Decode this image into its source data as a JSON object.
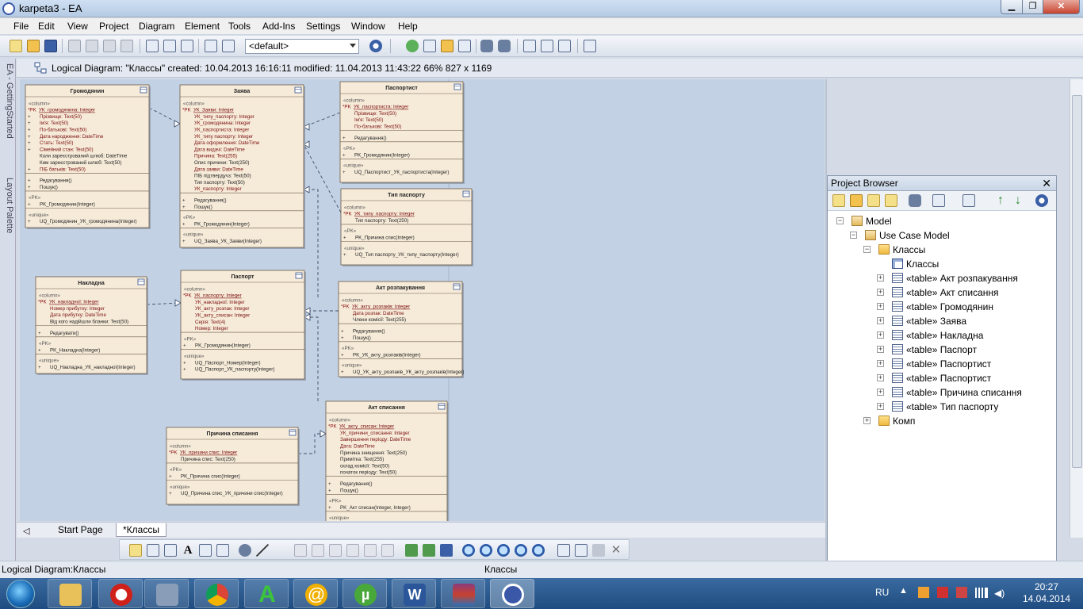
{
  "window": {
    "title": "karpeta3 - EA"
  },
  "menu": [
    "File",
    "Edit",
    "View",
    "Project",
    "Diagram",
    "Element",
    "Tools",
    "Add-Ins",
    "Settings",
    "Window",
    "Help"
  ],
  "toolbar": {
    "perspective_select": "<default>"
  },
  "side_tabs": [
    "EA - GettingStarted",
    "Layout Palette"
  ],
  "diagram_header": {
    "text": "Logical Diagram: \"Классы\"   created: 10.04.2013 16:16:11  modified: 11.04.2013 11:43:22   66%   827 x 1169"
  },
  "diagram": {
    "classes": [
      {
        "name": "Громодянин",
        "sections": [
          {
            "stereo": "«column»",
            "rows": [
              {
                "kind": "pk",
                "prefix": "*PK",
                "text": "УК_громодянина:  Integer"
              },
              {
                "kind": "col",
                "prefix": "+",
                "text": "Прізвище:  Text(50)"
              },
              {
                "kind": "col",
                "prefix": "+",
                "text": "Ім'я:  Text(50)"
              },
              {
                "kind": "col",
                "prefix": "+",
                "text": "По-батькові:  Text(50)"
              },
              {
                "kind": "col",
                "prefix": "+",
                "text": "Дата народження:  DateTime"
              },
              {
                "kind": "col",
                "prefix": "+",
                "text": "Стать:  Text(50)"
              },
              {
                "kind": "col",
                "prefix": "+",
                "text": "Сімейний стан:  Text(50)"
              },
              {
                "kind": "plain",
                "prefix": "",
                "text": "Коли зареєстрований шлюб:  DateTime"
              },
              {
                "kind": "plain",
                "prefix": "",
                "text": "Ким зареєстрований шлюб:  Text(50)"
              },
              {
                "kind": "col",
                "prefix": "+",
                "text": "ПІБ батьків:  Text(50)"
              }
            ]
          },
          {
            "stereo": "",
            "rows": [
              {
                "kind": "plain",
                "prefix": "+",
                "text": "Редагування()"
              },
              {
                "kind": "plain",
                "prefix": "+",
                "text": "Пошук()"
              }
            ]
          },
          {
            "stereo": "«PK»",
            "rows": [
              {
                "kind": "plain",
                "prefix": "+",
                "text": "PK_Громодянин(Integer)"
              }
            ]
          },
          {
            "stereo": "«unique»",
            "rows": [
              {
                "kind": "plain",
                "prefix": "+",
                "text": "UQ_Громодянин_УК_громодянина(Integer)"
              }
            ]
          }
        ]
      },
      {
        "name": "Заява",
        "sections": [
          {
            "stereo": "«column»",
            "rows": [
              {
                "kind": "pk",
                "prefix": "*PK",
                "text": "УК_Заяви:  Integer"
              },
              {
                "kind": "col",
                "prefix": "",
                "text": "УК_типу_паспорту:  Integer"
              },
              {
                "kind": "col",
                "prefix": "",
                "text": "УК_громодянина:  Integer"
              },
              {
                "kind": "col",
                "prefix": "",
                "text": "УК_паспортиста:  Integer"
              },
              {
                "kind": "col",
                "prefix": "",
                "text": "УК_типу паспорту:  Integer"
              },
              {
                "kind": "col",
                "prefix": "",
                "text": "Дата оформлення:  DateTime"
              },
              {
                "kind": "col",
                "prefix": "",
                "text": "Дата видачі:  DateTime"
              },
              {
                "kind": "col",
                "prefix": "",
                "text": "Причина:  Text(255)"
              },
              {
                "kind": "plain",
                "prefix": "",
                "text": "Опис причини:  Text(250)"
              },
              {
                "kind": "col",
                "prefix": "",
                "text": "Дата заяви:  DateTime"
              },
              {
                "kind": "plain",
                "prefix": "",
                "text": "ПІБ підтвердучз:  Text(50)"
              },
              {
                "kind": "plain",
                "prefix": "",
                "text": "Тип паспорту:  Text(50)"
              },
              {
                "kind": "col",
                "prefix": "",
                "text": "УК_паспорту:  Integer"
              }
            ]
          },
          {
            "stereo": "",
            "rows": [
              {
                "kind": "plain",
                "prefix": "+",
                "text": "Редагування()"
              },
              {
                "kind": "plain",
                "prefix": "+",
                "text": "Пошук()"
              }
            ]
          },
          {
            "stereo": "«PK»",
            "rows": [
              {
                "kind": "plain",
                "prefix": "+",
                "text": "PK_Громодянин(Integer)"
              }
            ]
          },
          {
            "stereo": "«unique»",
            "rows": [
              {
                "kind": "plain",
                "prefix": "+",
                "text": "UQ_Заява_УК_Заяви(Integer)"
              }
            ]
          }
        ]
      },
      {
        "name": "Паспортист",
        "sections": [
          {
            "stereo": "«column»",
            "rows": [
              {
                "kind": "pk",
                "prefix": "*PK",
                "text": "УК_паспортиста:  Integer"
              },
              {
                "kind": "col",
                "prefix": "",
                "text": "Прізвище:  Text(50)"
              },
              {
                "kind": "col",
                "prefix": "",
                "text": "Ім'я:  Text(50)"
              },
              {
                "kind": "col",
                "prefix": "",
                "text": "По-батькові:  Text(50)"
              }
            ]
          },
          {
            "stereo": "",
            "rows": [
              {
                "kind": "plain",
                "prefix": "+",
                "text": "Редагування()"
              }
            ]
          },
          {
            "stereo": "«PK»",
            "rows": [
              {
                "kind": "plain",
                "prefix": "+",
                "text": "PK_Громодянин(Integer)"
              }
            ]
          },
          {
            "stereo": "«unique»",
            "rows": [
              {
                "kind": "plain",
                "prefix": "+",
                "text": "UQ_Паспортист_УК_паспортиста(Integer)"
              }
            ]
          }
        ]
      },
      {
        "name": "Тип паспорту",
        "sections": [
          {
            "stereo": "«column»",
            "rows": [
              {
                "kind": "pk",
                "prefix": "*PK",
                "text": "УК_типу_паспорту:  Integer"
              },
              {
                "kind": "plain",
                "prefix": "",
                "text": "Тип паспорту:  Text(250)"
              }
            ]
          },
          {
            "stereo": "«PK»",
            "rows": [
              {
                "kind": "plain",
                "prefix": "+",
                "text": "PK_Причина спис(Integer)"
              }
            ]
          },
          {
            "stereo": "«unique»",
            "rows": [
              {
                "kind": "plain",
                "prefix": "+",
                "text": "UQ_Тип паспорту_УК_типу_паспорту(Integer)"
              }
            ]
          }
        ]
      },
      {
        "name": "Накладна",
        "sections": [
          {
            "stereo": "«column»",
            "rows": [
              {
                "kind": "pk",
                "prefix": "*PK",
                "text": "УК_накладної:  Integer"
              },
              {
                "kind": "col",
                "prefix": "",
                "text": "Номер прибутку:  Integer"
              },
              {
                "kind": "col",
                "prefix": "",
                "text": "Дата прибутку:  DateTime"
              },
              {
                "kind": "plain",
                "prefix": "",
                "text": "Від кого надійшли бланки:  Text(50)"
              }
            ]
          },
          {
            "stereo": "",
            "rows": [
              {
                "kind": "plain",
                "prefix": "+",
                "text": "Редагувати()"
              }
            ]
          },
          {
            "stereo": "«PK»",
            "rows": [
              {
                "kind": "plain",
                "prefix": "+",
                "text": "PK_Накладна(Integer)"
              }
            ]
          },
          {
            "stereo": "«unique»",
            "rows": [
              {
                "kind": "plain",
                "prefix": "+",
                "text": "UQ_Накладна_УК_накладної(Integer)"
              }
            ]
          }
        ]
      },
      {
        "name": "Паспорт",
        "sections": [
          {
            "stereo": "«column»",
            "rows": [
              {
                "kind": "pk",
                "prefix": "*PK",
                "text": "УК_паспорту:  Integer"
              },
              {
                "kind": "col",
                "prefix": "",
                "text": "УК_накладної:  Integer"
              },
              {
                "kind": "col",
                "prefix": "",
                "text": "УК_акту_розпак:  Integer"
              },
              {
                "kind": "col",
                "prefix": "",
                "text": "УК_акту_списан:  Integer"
              },
              {
                "kind": "col",
                "prefix": "",
                "text": "Серія:  Text(4)"
              },
              {
                "kind": "col",
                "prefix": "",
                "text": "Номер:  Integer"
              }
            ]
          },
          {
            "stereo": "«PK»",
            "rows": [
              {
                "kind": "plain",
                "prefix": "+",
                "text": "PK_Громодянин(Integer)"
              }
            ]
          },
          {
            "stereo": "«unique»",
            "rows": [
              {
                "kind": "plain",
                "prefix": "+",
                "text": "UQ_Паспорт_Номер(Integer)"
              },
              {
                "kind": "plain",
                "prefix": "+",
                "text": "UQ_Паспорт_УК_паспорту(Integer)"
              }
            ]
          }
        ]
      },
      {
        "name": "Акт розпакування",
        "sections": [
          {
            "stereo": "«column»",
            "rows": [
              {
                "kind": "pk",
                "prefix": "*PK",
                "text": "УК_акту_розпаків:  Integer"
              },
              {
                "kind": "col",
                "prefix": "",
                "text": "Дата розпак:  DateTime"
              },
              {
                "kind": "plain",
                "prefix": "",
                "text": "Члени комісії:  Text(255)"
              }
            ]
          },
          {
            "stereo": "",
            "rows": [
              {
                "kind": "plain",
                "prefix": "+",
                "text": "Редагування()"
              },
              {
                "kind": "plain",
                "prefix": "+",
                "text": "Пошук()"
              }
            ]
          },
          {
            "stereo": "«PK»",
            "rows": [
              {
                "kind": "plain",
                "prefix": "+",
                "text": "PK_УК_акту_розпаків(Integer)"
              }
            ]
          },
          {
            "stereo": "«unique»",
            "rows": [
              {
                "kind": "plain",
                "prefix": "+",
                "text": "UQ_УК_акту_розпаків_УК_акту_розпаків(Integer)"
              }
            ]
          }
        ]
      },
      {
        "name": "Причина списання",
        "sections": [
          {
            "stereo": "«column»",
            "rows": [
              {
                "kind": "pk",
                "prefix": "*PK",
                "text": "УК_причини спис:  Integer"
              },
              {
                "kind": "plain",
                "prefix": "",
                "text": "Причина спис:  Text(250)"
              }
            ]
          },
          {
            "stereo": "«PK»",
            "rows": [
              {
                "kind": "plain",
                "prefix": "+",
                "text": "PK_Причина спис(Integer)"
              }
            ]
          },
          {
            "stereo": "«unique»",
            "rows": [
              {
                "kind": "plain",
                "prefix": "+",
                "text": "UQ_Причина спис_УК_причини спис(Integer)"
              }
            ]
          }
        ]
      },
      {
        "name": "Акт списання",
        "sections": [
          {
            "stereo": "«column»",
            "rows": [
              {
                "kind": "pk",
                "prefix": "*PK",
                "text": "УК_акту_списан:  Integer"
              },
              {
                "kind": "col",
                "prefix": "",
                "text": "УК_причини_списання:  Integer"
              },
              {
                "kind": "col",
                "prefix": "",
                "text": "Завершення періоду:  DateTime"
              },
              {
                "kind": "col",
                "prefix": "",
                "text": "Дата:  DateTime"
              },
              {
                "kind": "plain",
                "prefix": "",
                "text": "Причина знищення:  Text(250)"
              },
              {
                "kind": "plain",
                "prefix": "",
                "text": "Примітка:  Text(255)"
              },
              {
                "kind": "plain",
                "prefix": "",
                "text": "склад комісії:  Text(50)"
              },
              {
                "kind": "plain",
                "prefix": "",
                "text": "початок періоду:  Text(50)"
              }
            ]
          },
          {
            "stereo": "",
            "rows": [
              {
                "kind": "plain",
                "prefix": "+",
                "text": "Редагування()"
              },
              {
                "kind": "plain",
                "prefix": "+",
                "text": "Пошук()"
              }
            ]
          },
          {
            "stereo": "«PK»",
            "rows": [
              {
                "kind": "plain",
                "prefix": "+",
                "text": "PK_Акт списан(Integer, Integer)"
              }
            ]
          },
          {
            "stereo": "«unique»",
            "rows": []
          }
        ]
      }
    ]
  },
  "tabs": {
    "start": "Start Page",
    "current": "*Классы"
  },
  "status": {
    "left": "Logical Diagram:Классы",
    "center": "Классы"
  },
  "project_browser": {
    "title": "Project Browser",
    "tree": [
      {
        "label": "Model",
        "icon": "model",
        "level": 0,
        "expander": "−"
      },
      {
        "label": "Use Case Model",
        "icon": "package",
        "level": 1,
        "expander": "−"
      },
      {
        "label": "Классы",
        "icon": "folder",
        "level": 2,
        "expander": "−"
      },
      {
        "label": "Классы",
        "icon": "diagram",
        "level": 3,
        "expander": ""
      },
      {
        "label": "«table» Акт розпакування",
        "icon": "table",
        "level": 3,
        "expander": "+"
      },
      {
        "label": "«table» Акт списання",
        "icon": "table",
        "level": 3,
        "expander": "+"
      },
      {
        "label": "«table» Громодянин",
        "icon": "table",
        "level": 3,
        "expander": "+"
      },
      {
        "label": "«table» Заява",
        "icon": "table",
        "level": 3,
        "expander": "+"
      },
      {
        "label": "«table» Накладна",
        "icon": "table",
        "level": 3,
        "expander": "+"
      },
      {
        "label": "«table» Паспорт",
        "icon": "table",
        "level": 3,
        "expander": "+"
      },
      {
        "label": "«table» Паспортист",
        "icon": "table",
        "level": 3,
        "expander": "+"
      },
      {
        "label": "«table» Паспортист",
        "icon": "table",
        "level": 3,
        "expander": "+"
      },
      {
        "label": "«table» Причина списання",
        "icon": "table",
        "level": 3,
        "expander": "+"
      },
      {
        "label": "«table» Тип паспорту",
        "icon": "table",
        "level": 3,
        "expander": "+"
      },
      {
        "label": "Комп",
        "icon": "folder",
        "level": 2,
        "expander": "+"
      }
    ]
  },
  "taskbar": {
    "language": "RU",
    "time": "20:27",
    "date": "14.04.2014"
  }
}
